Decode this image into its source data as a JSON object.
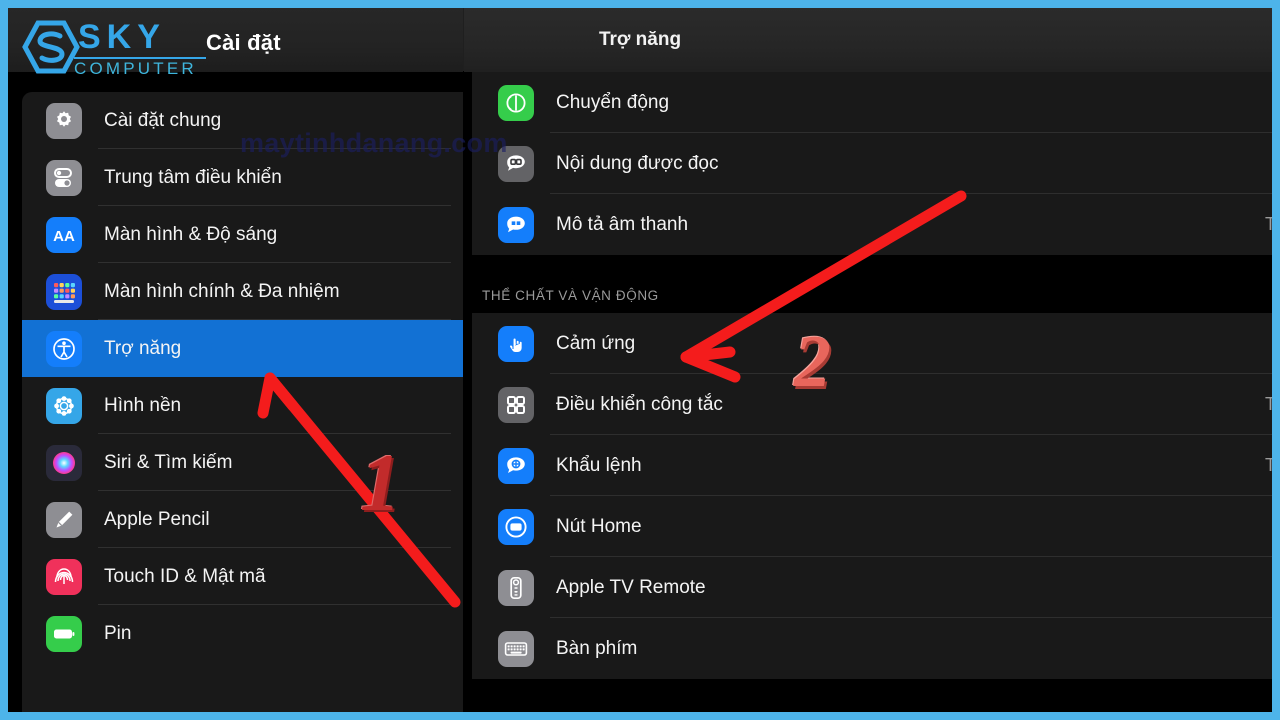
{
  "window": {
    "frame_color": "#4db4ea",
    "background": "#000000"
  },
  "branding": {
    "logo_sky": "SKY",
    "logo_computer": "COMPUTER",
    "logo_color": "#35a6e8",
    "watermark": "maytinhdanang.com",
    "watermark_color": "#1b1f63"
  },
  "header": {
    "settings_title": "Cài đặt",
    "panel_title": "Trợ năng"
  },
  "sidebar": {
    "selected_index": 4,
    "selected_color": "#1271d4",
    "items": [
      {
        "label": "Cài đặt chung",
        "icon": "gear-icon",
        "icon_bg": "#8e8e93"
      },
      {
        "label": "Trung tâm điều khiển",
        "icon": "toggles-icon",
        "icon_bg": "#8e8e93"
      },
      {
        "label": "Màn hình & Độ sáng",
        "icon": "aa-text-icon",
        "icon_bg": "#147efb"
      },
      {
        "label": "Màn hình chính & Đa nhiệm",
        "icon": "app-grid-icon",
        "icon_bg": "#1c4fd8"
      },
      {
        "label": "Trợ năng",
        "icon": "accessibility-icon",
        "icon_bg": "#147efb"
      },
      {
        "label": "Hình nền",
        "icon": "wallpaper-icon",
        "icon_bg": "#35a6e8"
      },
      {
        "label": "Siri & Tìm kiếm",
        "icon": "siri-icon",
        "icon_bg": "#2a2a3a"
      },
      {
        "label": "Apple Pencil",
        "icon": "pencil-icon",
        "icon_bg": "#8e8e93"
      },
      {
        "label": "Touch ID & Mật mã",
        "icon": "fingerprint-icon",
        "icon_bg": "#f0315b"
      },
      {
        "label": "Pin",
        "icon": "battery-icon",
        "icon_bg": "#35cd4b"
      }
    ]
  },
  "content": {
    "group_top": [
      {
        "label": "Chuyển động",
        "icon": "motion-icon",
        "icon_bg": "#35cd4b",
        "value": ""
      },
      {
        "label": "Nội dung được đọc",
        "icon": "spoken-content-icon",
        "icon_bg": "#636366",
        "value": ""
      },
      {
        "label": "Mô tả âm thanh",
        "icon": "audio-desc-icon",
        "icon_bg": "#147efb",
        "value": "T"
      }
    ],
    "section_title": "THỂ CHẤT VÀ VẬN ĐỘNG",
    "group_second": [
      {
        "label": "Cảm ứng",
        "icon": "touch-hand-icon",
        "icon_bg": "#147efb",
        "value": ""
      },
      {
        "label": "Điều khiển công tắc",
        "icon": "switch-control-icon",
        "icon_bg": "#636366",
        "value": "T"
      },
      {
        "label": "Khẩu lệnh",
        "icon": "voice-control-icon",
        "icon_bg": "#147efb",
        "value": "T"
      },
      {
        "label": "Nút Home",
        "icon": "home-button-icon",
        "icon_bg": "#147efb",
        "value": ""
      },
      {
        "label": "Apple TV Remote",
        "icon": "tv-remote-icon",
        "icon_bg": "#8e8e93",
        "value": ""
      },
      {
        "label": "Bàn phím",
        "icon": "keyboard-icon",
        "icon_bg": "#8e8e93",
        "value": ""
      }
    ]
  },
  "annotations": {
    "step1": "1",
    "step2": "2",
    "arrow_color": "#f41c1c"
  }
}
